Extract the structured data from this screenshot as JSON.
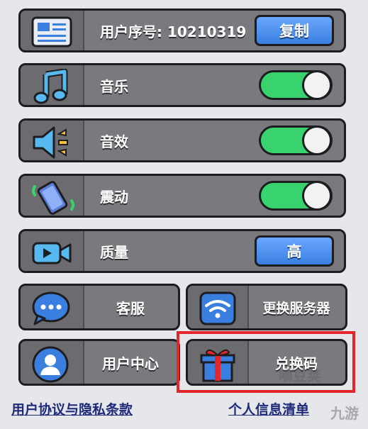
{
  "rows": {
    "user_id": {
      "label": "用户序号: 10210319",
      "button": "复制"
    },
    "music": {
      "label": "音乐",
      "toggle_on": true
    },
    "sound": {
      "label": "音效",
      "toggle_on": true
    },
    "vibration": {
      "label": "震动",
      "toggle_on": true
    },
    "quality": {
      "label": "质量",
      "button": "高"
    }
  },
  "tiles": {
    "service": "客服",
    "switch_server": "更换服务器",
    "user_center": "用户中心",
    "redeem": "兑换码"
  },
  "links": {
    "agreement": "用户协议与隐私条款",
    "personal_info": "个人信息清单"
  },
  "watermark": {
    "text1": "嘀豆荚",
    "text2": "九游"
  },
  "colors": {
    "toggle_on": "#38d36e",
    "button_blue": "#3a7fe0",
    "highlight": "#e2262b"
  }
}
